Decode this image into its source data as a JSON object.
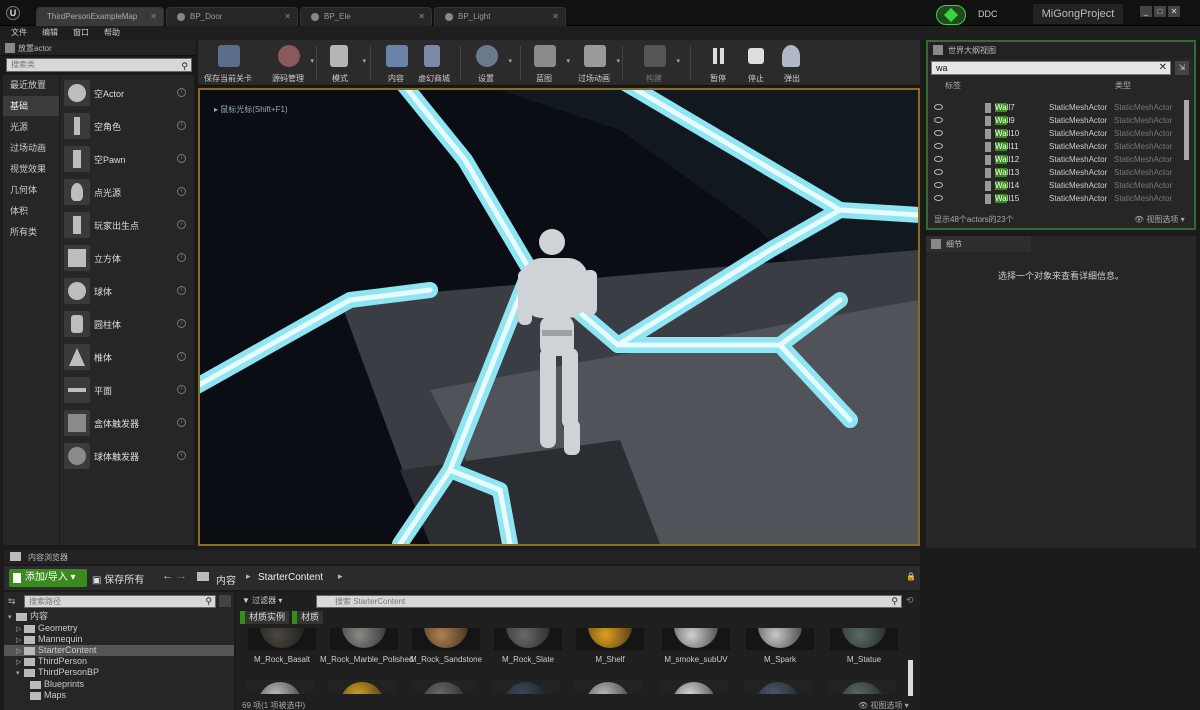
{
  "titlebar": {
    "tabs": [
      "ThirdPersonExampleMap",
      "BP_Door",
      "BP_Ele",
      "BP_Light"
    ],
    "ddc": "DDC",
    "project": "MiGongProject"
  },
  "menu": [
    "文件",
    "编辑",
    "窗口",
    "帮助"
  ],
  "place_panel": {
    "title": "放置actor",
    "search_placeholder": "搜索类",
    "categories": [
      "最近放置",
      "基础",
      "光源",
      "过场动画",
      "视觉效果",
      "几何体",
      "体积",
      "所有类"
    ],
    "selected_category": "基础",
    "items": [
      "空Actor",
      "空角色",
      "空Pawn",
      "点光源",
      "玩家出生点",
      "立方体",
      "球体",
      "圆柱体",
      "椎体",
      "平面",
      "盒体触发器",
      "球体触发器"
    ]
  },
  "toolbar": {
    "buttons": [
      "保存当前关卡",
      "源码管理",
      "模式",
      "内容",
      "虚幻商城",
      "设置",
      "蓝图",
      "过场动画",
      "构建",
      "暂停",
      "停止",
      "弹出"
    ]
  },
  "viewport": {
    "hint": "鼠标光标(Shift+F1)"
  },
  "outliner": {
    "title": "世界大纲视图",
    "search_value": "wa",
    "col_label": "标签",
    "col_type": "类型",
    "rows": [
      {
        "name": "Wall7",
        "type": "StaticMeshActor"
      },
      {
        "name": "Wall9",
        "type": "StaticMeshActor"
      },
      {
        "name": "Wall10",
        "type": "StaticMeshActor"
      },
      {
        "name": "Wall11",
        "type": "StaticMeshActor"
      },
      {
        "name": "Wall12",
        "type": "StaticMeshActor"
      },
      {
        "name": "Wall13",
        "type": "StaticMeshActor"
      },
      {
        "name": "Wall14",
        "type": "StaticMeshActor"
      },
      {
        "name": "Wall15",
        "type": "StaticMeshActor"
      }
    ],
    "status": "显示48个actors的23个",
    "view_options": "视图选项"
  },
  "details": {
    "title": "细节",
    "message": "选择一个对象来查看详细信息。"
  },
  "content_browser": {
    "title": "内容浏览器",
    "add_import": "添加/导入",
    "save_all": "保存所有",
    "path": [
      "内容",
      "StarterContent"
    ],
    "folder_search_placeholder": "搜索路径",
    "tree": [
      {
        "label": "内容",
        "depth": 0
      },
      {
        "label": "Geometry",
        "depth": 1
      },
      {
        "label": "Mannequin",
        "depth": 1
      },
      {
        "label": "StarterContent",
        "depth": 1
      },
      {
        "label": "ThirdPerson",
        "depth": 1
      },
      {
        "label": "ThirdPersonBP",
        "depth": 1
      },
      {
        "label": "Blueprints",
        "depth": 2
      },
      {
        "label": "Maps",
        "depth": 2
      }
    ],
    "selected_folder": "StarterContent",
    "filter_label": "过滤器",
    "asset_search_placeholder": "搜索 StarterContent",
    "chips": [
      "材质实例",
      "材质"
    ],
    "assets": [
      {
        "name": "M_Rock_Basalt",
        "color": "#4a4540"
      },
      {
        "name": "M_Rock_Marble_Polished",
        "color": "#8a8a86"
      },
      {
        "name": "M_Rock_Sandstone",
        "color": "#b08050"
      },
      {
        "name": "M_Rock_Slate",
        "color": "#6a6a6a"
      },
      {
        "name": "M_Shelf",
        "color": "#e0a020"
      },
      {
        "name": "M_smoke_subUV",
        "color": "#d0d0d0"
      },
      {
        "name": "M_Spark",
        "color": "#c8c8c8"
      },
      {
        "name": "M_Statue",
        "color": "#5a6a66"
      }
    ],
    "status": "69 项(1 项被选中)",
    "view_options": "视图选项"
  }
}
